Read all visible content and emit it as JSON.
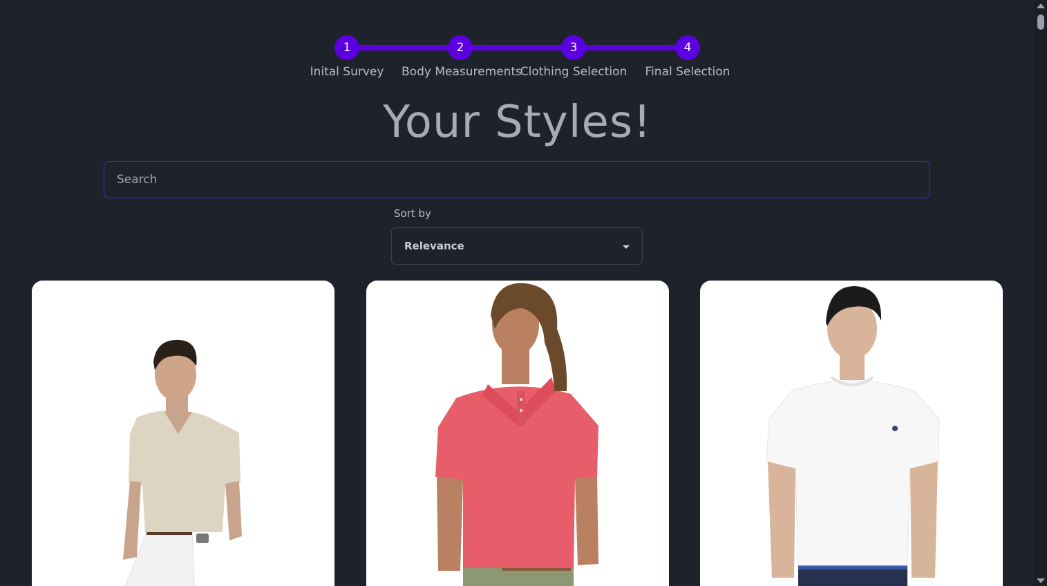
{
  "stepper": {
    "steps": [
      {
        "number": "1",
        "label": "Inital Survey"
      },
      {
        "number": "2",
        "label": "Body Measurements"
      },
      {
        "number": "3",
        "label": "Clothing Selection"
      },
      {
        "number": "4",
        "label": "Final Selection"
      }
    ],
    "accent_color": "#5b00e0"
  },
  "page_title": "Your Styles!",
  "search": {
    "placeholder": "Search",
    "value": ""
  },
  "sort": {
    "label": "Sort by",
    "selected": "Relevance"
  },
  "products": [
    {
      "image": "model-beige-v-neck-tee"
    },
    {
      "image": "model-pink-polo-shirt"
    },
    {
      "image": "model-white-crew-tee"
    }
  ]
}
